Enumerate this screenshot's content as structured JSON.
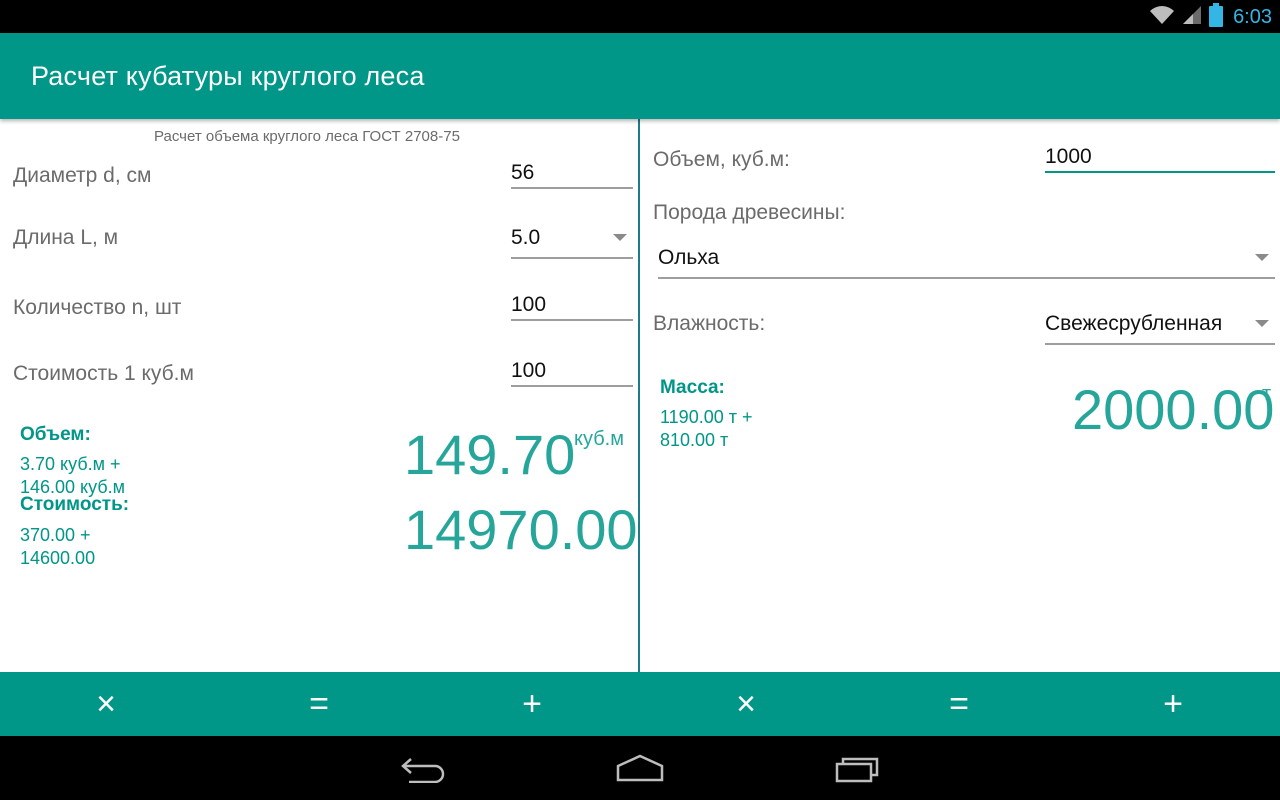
{
  "status": {
    "time": "6:03",
    "icons": [
      "wifi-icon",
      "signal-icon",
      "battery-icon"
    ],
    "time_color": "#33b5e5"
  },
  "app": {
    "title": "Расчет кубатуры круглого леса",
    "accent": "#009688"
  },
  "left": {
    "subtitle": "Расчет объема круглого леса ГОСТ 2708-75",
    "diameter": {
      "label": "Диаметр d, см",
      "value": "56"
    },
    "length": {
      "label": "Длина L, м",
      "value": "5.0"
    },
    "count": {
      "label": "Количество n, шт",
      "value": "100"
    },
    "cost": {
      "label": "Стоимость 1 куб.м",
      "value": "100"
    },
    "volume": {
      "title": "Объем:",
      "line1": "3.70 куб.м +",
      "line2": "146.00 куб.м",
      "total": "149.70",
      "unit": "куб.м"
    },
    "price": {
      "title": "Стоимость:",
      "line1": "370.00 +",
      "line2": "14600.00",
      "total": "14970.00"
    }
  },
  "right": {
    "volume": {
      "label": "Объем, куб.м:",
      "value": "1000"
    },
    "species": {
      "label": "Порода древесины:",
      "value": "Ольха"
    },
    "humidity": {
      "label": "Влажность:",
      "value": "Свежесрубленная"
    },
    "mass": {
      "title": "Масса:",
      "line1": "1190.00 т +",
      "line2": "810.00 т",
      "total": "2000.00",
      "unit": "т"
    }
  },
  "ops": {
    "left": [
      "×",
      "=",
      "+"
    ],
    "right": [
      "×",
      "=",
      "+"
    ]
  },
  "nav": [
    "back-icon",
    "home-icon",
    "recent-apps-icon"
  ]
}
